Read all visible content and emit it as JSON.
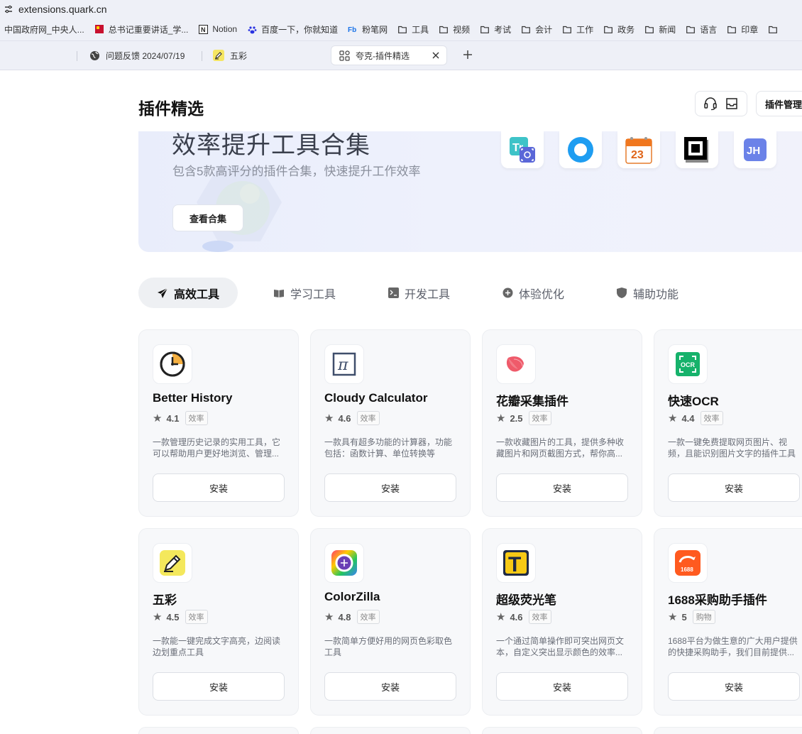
{
  "browser": {
    "url": "extensions.quark.cn",
    "bookmarks": [
      {
        "label": "中国政府网_中央人...",
        "icon": "none"
      },
      {
        "label": "总书记重要讲话_学...",
        "icon": "flag-icon"
      },
      {
        "label": "Notion",
        "icon": "notion-icon"
      },
      {
        "label": "百度一下，你就知道",
        "icon": "baidu-icon"
      },
      {
        "label": "粉笔网",
        "icon": "fenbi-icon"
      },
      {
        "label": "工具",
        "icon": "folder-icon"
      },
      {
        "label": "视频",
        "icon": "folder-icon"
      },
      {
        "label": "考试",
        "icon": "folder-icon"
      },
      {
        "label": "会计",
        "icon": "folder-icon"
      },
      {
        "label": "工作",
        "icon": "folder-icon"
      },
      {
        "label": "政务",
        "icon": "folder-icon"
      },
      {
        "label": "新闻",
        "icon": "folder-icon"
      },
      {
        "label": "语言",
        "icon": "folder-icon"
      },
      {
        "label": "印章",
        "icon": "folder-icon"
      }
    ],
    "tabs": [
      {
        "label": "问题反馈 2024/07/19",
        "icon": "globe-icon"
      },
      {
        "label": "五彩",
        "icon": "wucai-icon"
      },
      {
        "label": "夸克-插件精选",
        "icon": "extensions-icon"
      }
    ]
  },
  "header": {
    "title": "插件精选",
    "manage_label": "插件管理"
  },
  "banner": {
    "title": "效率提升工具合集",
    "subtitle": "包含5款高评分的插件合集，快速提升工作效率",
    "button": "查看合集",
    "jh_label": "JH",
    "cal_label": "23"
  },
  "categories": [
    {
      "label": "高效工具",
      "icon": "paper-plane-icon",
      "active": true
    },
    {
      "label": "学习工具",
      "icon": "book-icon",
      "active": false
    },
    {
      "label": "开发工具",
      "icon": "code-icon",
      "active": false
    },
    {
      "label": "体验优化",
      "icon": "plus-circle-icon",
      "active": false
    },
    {
      "label": "辅助功能",
      "icon": "shield-icon",
      "active": false
    }
  ],
  "cards": [
    {
      "name": "Better History",
      "score": "4.1",
      "tag": "效率",
      "desc": "一款管理历史记录的实用工具，它可以帮助用户更好地浏览、管理...",
      "button": "安装",
      "icon": "clock-icon"
    },
    {
      "name": "Cloudy Calculator",
      "score": "4.6",
      "tag": "效率",
      "desc": "一款具有超多功能的计算器，功能包括：函数计算、单位转换等",
      "button": "安装",
      "icon": "pi-icon"
    },
    {
      "name": "花瓣采集插件",
      "score": "2.5",
      "tag": "效率",
      "desc": "一款收藏图片的工具，提供多种收藏图片和网页截图方式，帮你高...",
      "button": "安装",
      "icon": "petal-icon"
    },
    {
      "name": "快速OCR",
      "score": "4.4",
      "tag": "效率",
      "desc": "一款一键免费提取网页图片、视频，且能识别图片文字的插件工具",
      "button": "安装",
      "icon": "ocr-icon",
      "icon_text": "OCR"
    },
    {
      "name": "五彩",
      "score": "4.5",
      "tag": "效率",
      "desc": "一款能一键完成文字高亮，边阅读边划重点工具",
      "button": "安装",
      "icon": "pen-icon"
    },
    {
      "name": "ColorZilla",
      "score": "4.8",
      "tag": "效率",
      "desc": "一款简单方便好用的网页色彩取色工具",
      "button": "安装",
      "icon": "color-wheel-icon"
    },
    {
      "name": "超级荧光笔",
      "score": "4.6",
      "tag": "效率",
      "desc": "一个通过简单操作即可突出网页文本，自定义突出显示颜色的效率...",
      "button": "安装",
      "icon": "letter-t-icon",
      "icon_text": "T"
    },
    {
      "name": "1688采购助手插件",
      "score": "5",
      "tag": "购物",
      "desc": "1688平台为做生意的广大用户提供的快捷采购助手，我们目前提供...",
      "button": "安装",
      "icon": "1688-icon",
      "icon_text": "1688"
    }
  ],
  "colors": {
    "accent": "#111111",
    "banner_bg": "#eceffb",
    "card_bg": "#f7f8fa"
  }
}
